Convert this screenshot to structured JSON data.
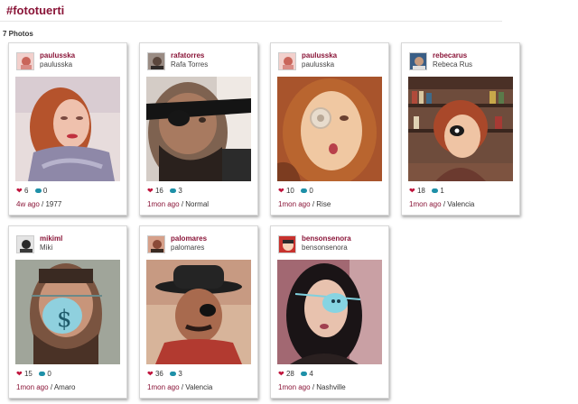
{
  "header": {
    "hashtag": "#fototuerti",
    "count_label": "7 Photos"
  },
  "cards": [
    {
      "username": "paulusska",
      "fullname": "paulusska",
      "likes": "6",
      "comments": "0",
      "time": "4w ago",
      "filter": "1977"
    },
    {
      "username": "rafatorres",
      "fullname": "Rafa Torres",
      "likes": "16",
      "comments": "3",
      "time": "1mon ago",
      "filter": "Normal"
    },
    {
      "username": "paulusska",
      "fullname": "paulusska",
      "likes": "10",
      "comments": "0",
      "time": "1mon ago",
      "filter": "Rise"
    },
    {
      "username": "rebecarus",
      "fullname": "Rebeca Rus",
      "likes": "18",
      "comments": "1",
      "time": "1mon ago",
      "filter": "Valencia"
    },
    {
      "username": "mikiml",
      "fullname": "Miki",
      "likes": "15",
      "comments": "0",
      "time": "1mon ago",
      "filter": "Amaro"
    },
    {
      "username": "palomares",
      "fullname": "palomares",
      "likes": "36",
      "comments": "3",
      "time": "1mon ago",
      "filter": "Valencia"
    },
    {
      "username": "bensonsenora",
      "fullname": "bensonsenora",
      "likes": "28",
      "comments": "4",
      "time": "1mon ago",
      "filter": "Nashville"
    }
  ],
  "icons": {
    "like": "heart-icon",
    "comment": "comment-bubble-icon"
  },
  "colors": {
    "accent": "#8a1538",
    "heart": "#c0143c",
    "comment": "#1e90a8"
  }
}
